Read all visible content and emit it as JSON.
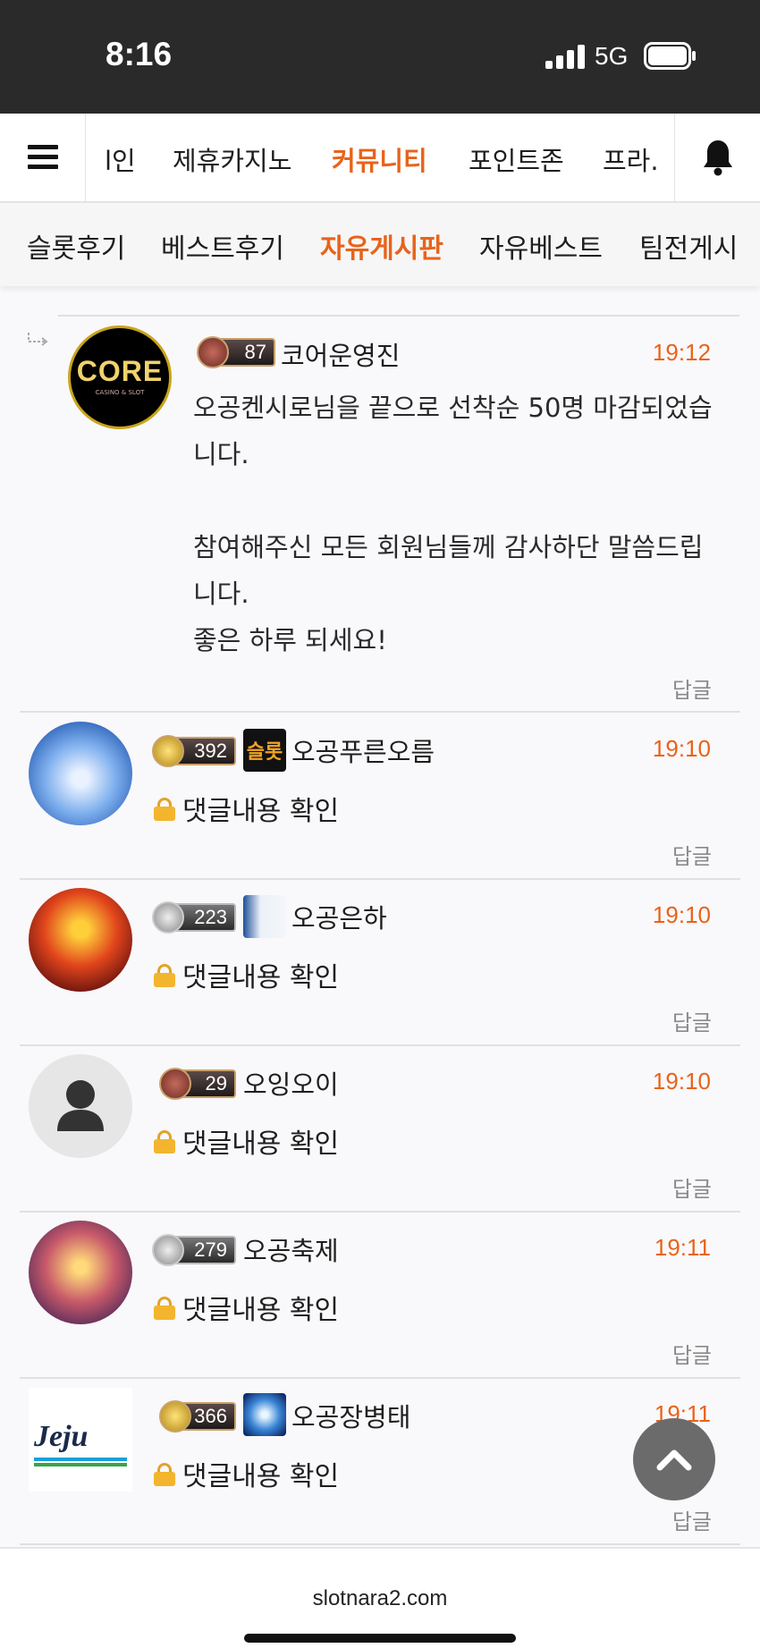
{
  "status": {
    "time": "8:16",
    "network": "5G"
  },
  "nav": {
    "items": [
      "l인",
      "제휴카지노",
      "커뮤니티",
      "포인트존",
      "프라."
    ],
    "active_index": 2
  },
  "subnav": {
    "items": [
      "슬롯후기",
      "베스트후기",
      "자유게시판",
      "자유베스트",
      "팀전게시"
    ],
    "active_index": 2
  },
  "reply_label": "답글",
  "locked_text": "댓글내용 확인",
  "comments": [
    {
      "level": "87",
      "author": "코어운영진",
      "time": "19:12",
      "text_lines": [
        "오공켄시로님을 끝으로 선착순 50명 마감되었습",
        "니다.",
        "",
        "참여해주신 모든 회원님들께 감사하단 말씀드립",
        "니다.",
        "좋은 하루 되세요!"
      ],
      "avatar_text": "CORE",
      "avatar_sub": "CASINO & SLOT"
    },
    {
      "level": "392",
      "author": "오공푸른오름",
      "time": "19:10",
      "tag": "슬롯"
    },
    {
      "level": "223",
      "author": "오공은하",
      "time": "19:10"
    },
    {
      "level": "29",
      "author": "오잉오이",
      "time": "19:10"
    },
    {
      "level": "279",
      "author": "오공축제",
      "time": "19:11"
    },
    {
      "level": "366",
      "author": "오공장병태",
      "time": "19:11",
      "avatar_text": "Jeju"
    }
  ],
  "footer": {
    "url": "slotnara2.com"
  }
}
